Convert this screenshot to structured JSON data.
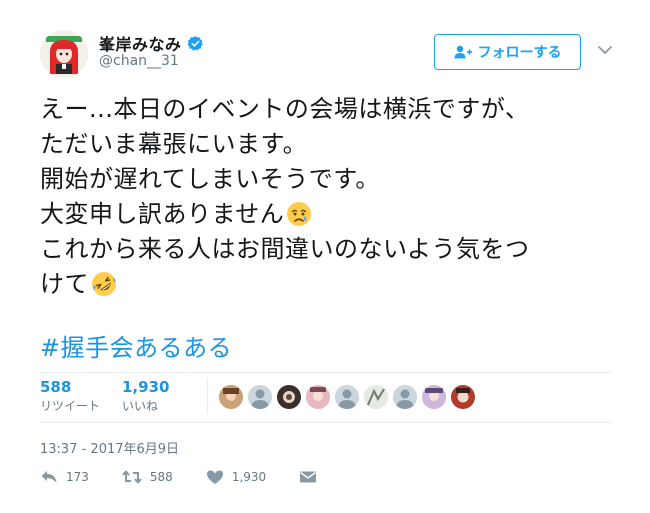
{
  "user": {
    "display_name": "峯岸みなみ",
    "handle": "@chan__31",
    "verified": true
  },
  "follow_button": {
    "label": "フォローする",
    "icon": "person-add-icon"
  },
  "tweet": {
    "lines": [
      "えー...本日のイベントの会場は横浜ですが、",
      "ただいま幕張にいます。",
      "開始が遅れてしまいそうです。",
      "大変申し訳ありません",
      "これから来る人はお間違いのないよう気をつ",
      "けて"
    ],
    "emojis": [
      "crying-face-emoji",
      "rolling-on-floor-laughing-emoji"
    ],
    "hashtag": "#握手会あるある"
  },
  "stats": {
    "retweets": {
      "count": "588",
      "label": "リツイート"
    },
    "likes": {
      "count": "1,930",
      "label": "いいね"
    }
  },
  "timestamp": "13:37 - 2017年6月9日",
  "actions": {
    "reply": {
      "count": "173",
      "icon": "reply-icon"
    },
    "retweet": {
      "count": "588",
      "icon": "retweet-icon"
    },
    "like": {
      "count": "1,930",
      "icon": "heart-icon"
    },
    "message": {
      "icon": "envelope-icon"
    }
  },
  "colors": {
    "accent": "#1da1f2",
    "link": "#1b95e0",
    "muted": "#657786"
  }
}
